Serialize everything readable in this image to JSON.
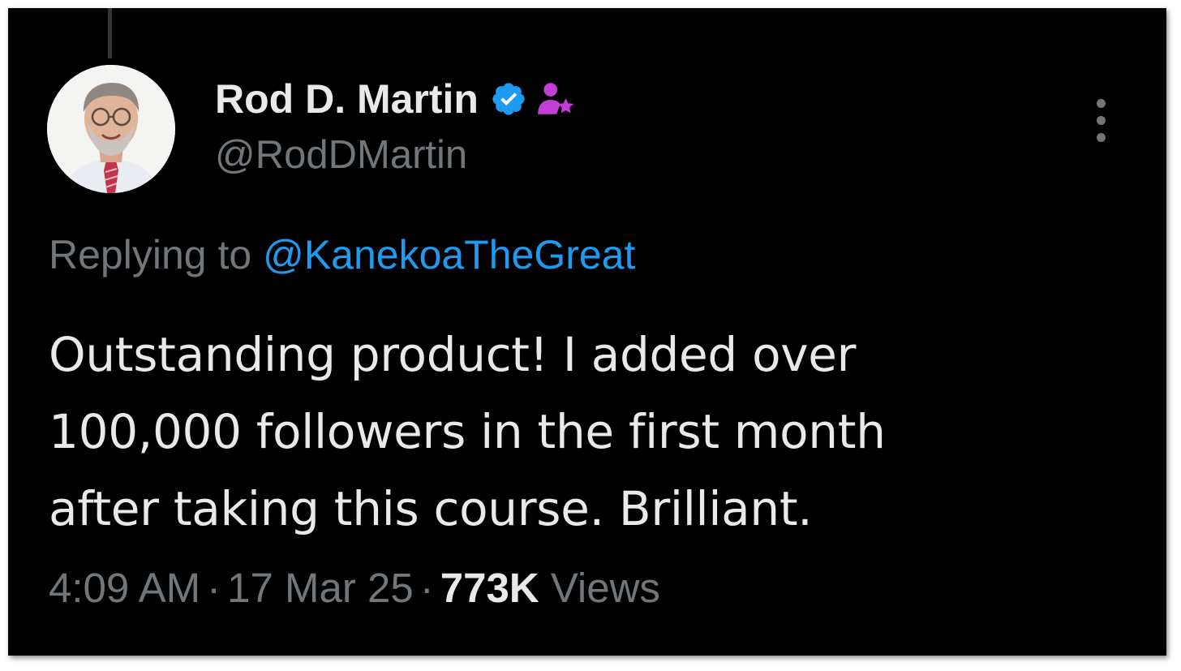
{
  "tweet": {
    "author": {
      "display_name": "Rod D. Martin",
      "handle": "@RodDMartin",
      "verified_icon": "verified-badge-icon",
      "affiliate_icon": "affiliate-person-star-icon"
    },
    "reply": {
      "prefix": "Replying to",
      "mention": "@KanekoaTheGreat"
    },
    "text_lines": [
      "Outstanding product! I added over",
      "100,000 followers in the first month",
      "after taking this course. Brilliant."
    ],
    "meta": {
      "time": "4:09 AM",
      "separator": "·",
      "date": "17 Mar 25",
      "views_count": "773K",
      "views_label": "Views"
    },
    "more_menu_icon": "vertical-ellipsis-icon"
  },
  "colors": {
    "background": "#000000",
    "primary_text": "#e7e9ea",
    "secondary_text": "#71767b",
    "link": "#1d9bf0",
    "verified": "#1d9bf0",
    "affiliate": "#c13fd6"
  }
}
